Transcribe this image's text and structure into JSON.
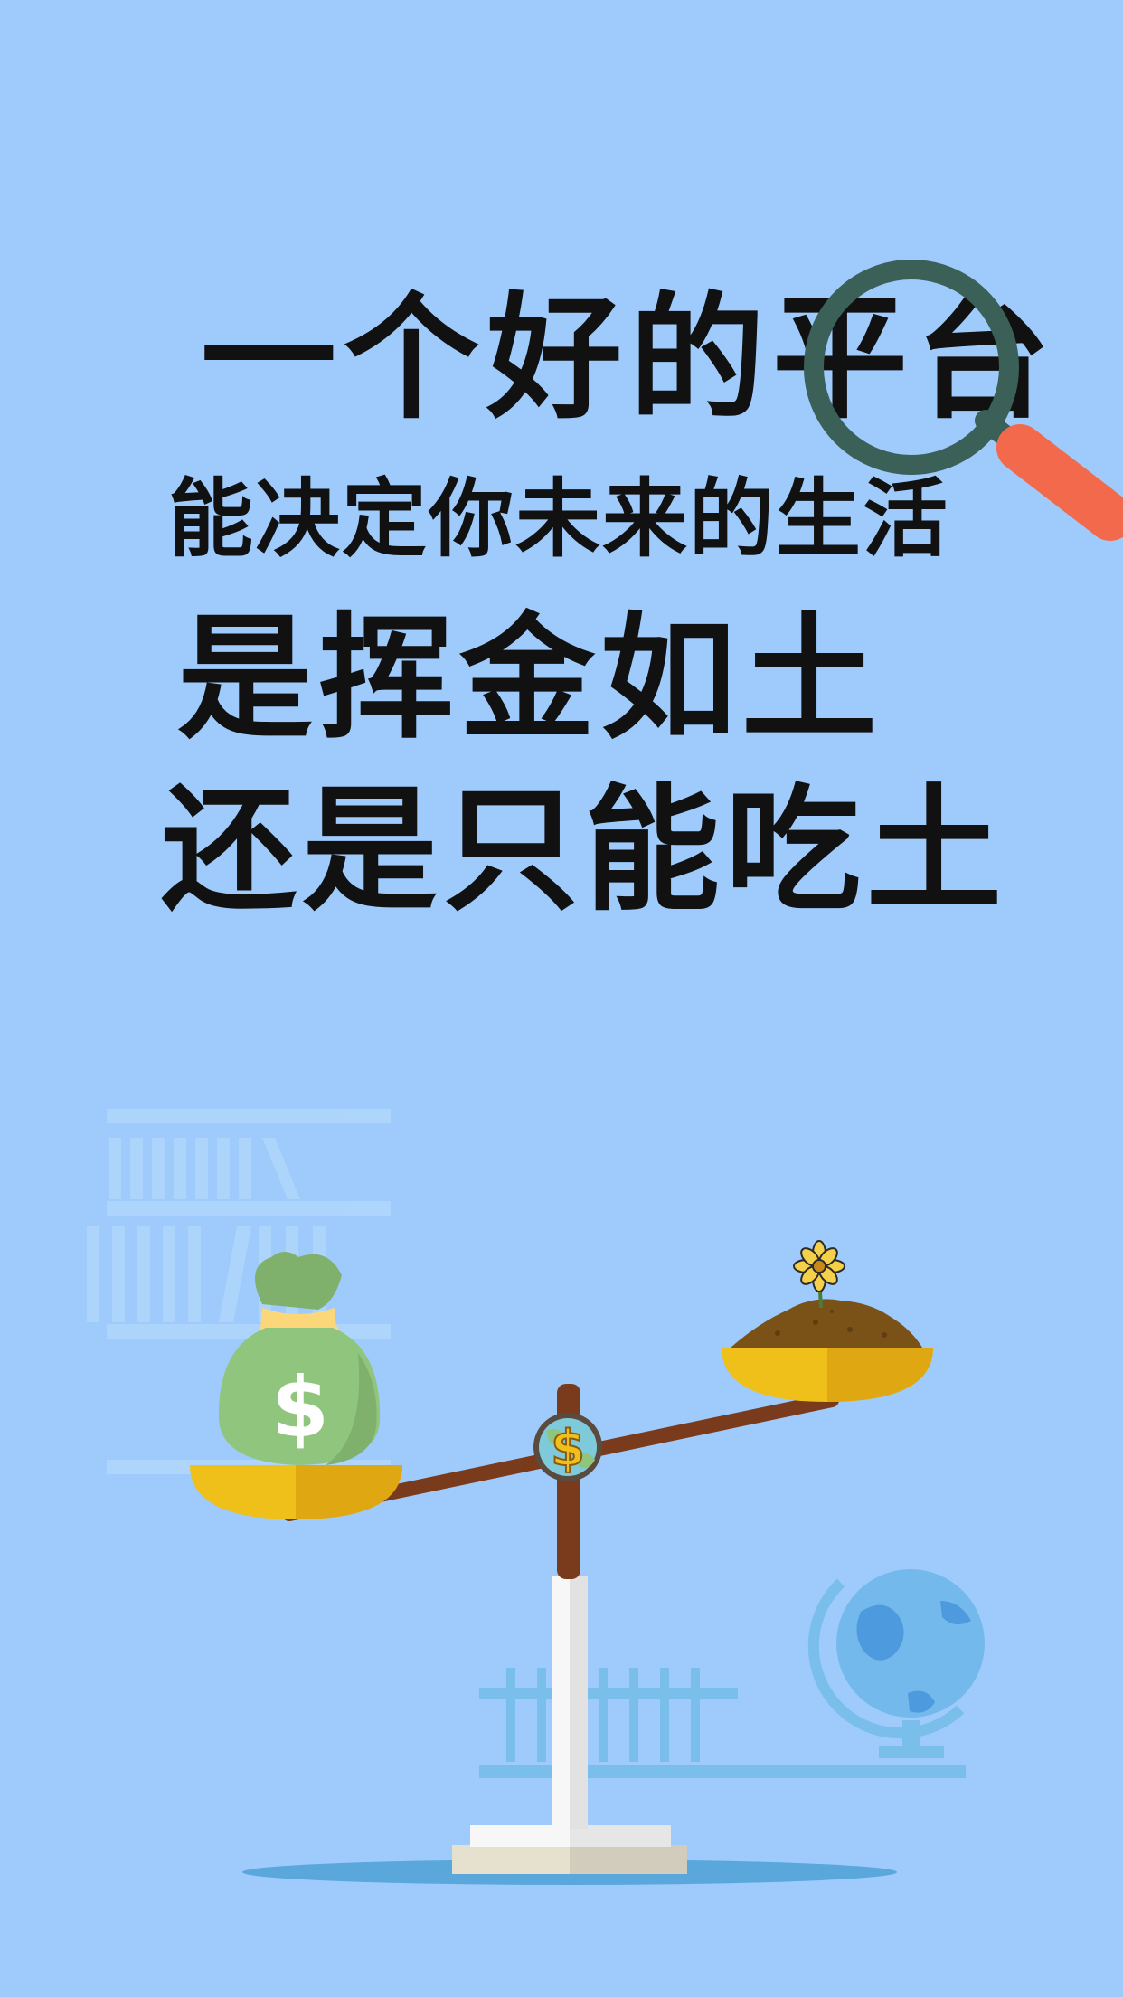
{
  "headline": {
    "line1": "一个好的平台",
    "line2": "能决定你未来的生活",
    "line3": "是挥金如土",
    "line4": "还是只能吃土"
  },
  "icons": {
    "magnifier": "magnifying-glass-icon",
    "money_bag": "money-bag-icon",
    "coin": "dollar-coin-icon",
    "soil": "soil-pile-icon",
    "flower": "flower-icon",
    "scale": "balance-scale-icon",
    "globe": "globe-icon",
    "bookshelf": "bookshelf-icon",
    "test_tubes": "test-tube-rack-icon"
  },
  "money_bag_symbol": "$",
  "coin_symbol": "$",
  "colors": {
    "background": "#9ecbfb",
    "text": "#111111",
    "bag_green": "#8fc57c",
    "pan_yellow": "#f0c01a",
    "beam_brown": "#7a3a1c",
    "magnifier_ring": "#3a6058",
    "magnifier_handle": "#f26a4b"
  }
}
